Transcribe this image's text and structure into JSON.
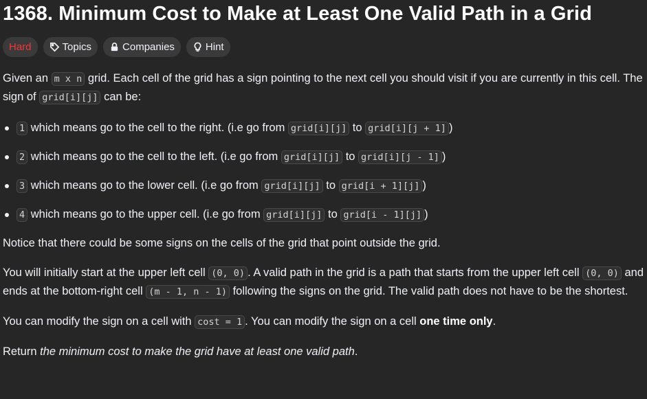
{
  "problem": {
    "title": "1368. Minimum Cost to Make at Least One Valid Path in a Grid"
  },
  "chips": {
    "difficulty": "Hard",
    "topics": "Topics",
    "companies": "Companies",
    "hint": "Hint"
  },
  "description": {
    "intro_a": "Given an ",
    "intro_code1": "m x n",
    "intro_b": " grid. Each cell of the grid has a sign pointing to the next cell you should visit if you are currently in this cell. The sign of ",
    "intro_code2": "grid[i][j]",
    "intro_c": " can be:",
    "bullets": [
      {
        "num": "1",
        "text": " which means go to the cell to the right. (i.e go from ",
        "from": "grid[i][j]",
        "to_word": " to ",
        "to": "grid[i][j + 1]",
        "end": ")"
      },
      {
        "num": "2",
        "text": " which means go to the cell to the left. (i.e go from ",
        "from": "grid[i][j]",
        "to_word": " to ",
        "to": "grid[i][j - 1]",
        "end": ")"
      },
      {
        "num": "3",
        "text": " which means go to the lower cell. (i.e go from ",
        "from": "grid[i][j]",
        "to_word": " to ",
        "to": "grid[i + 1][j]",
        "end": ")"
      },
      {
        "num": "4",
        "text": " which means go to the upper cell. (i.e go from ",
        "from": "grid[i][j]",
        "to_word": " to ",
        "to": "grid[i - 1][j]",
        "end": ")"
      }
    ],
    "notice": "Notice that there could be some signs on the cells of the grid that point outside the grid.",
    "start_a": "You will initially start at the upper left cell ",
    "start_code1": "(0, 0)",
    "start_b": ". A valid path in the grid is a path that starts from the upper left cell ",
    "start_code2": "(0, 0)",
    "start_c": " and ends at the bottom-right cell ",
    "start_code3": "(m - 1, n - 1)",
    "start_d": " following the signs on the grid. The valid path does not have to be the shortest.",
    "modify_a": "You can modify the sign on a cell with ",
    "modify_code": "cost = 1",
    "modify_b": ". You can modify the sign on a cell ",
    "modify_strong": "one time only",
    "modify_c": ".",
    "return_a": "Return ",
    "return_em": "the minimum cost to make the grid have at least one valid path",
    "return_b": "."
  },
  "colors": {
    "background": "#262626",
    "difficulty_hard": "#f63636",
    "chip_bg": "#3a3a3a"
  }
}
